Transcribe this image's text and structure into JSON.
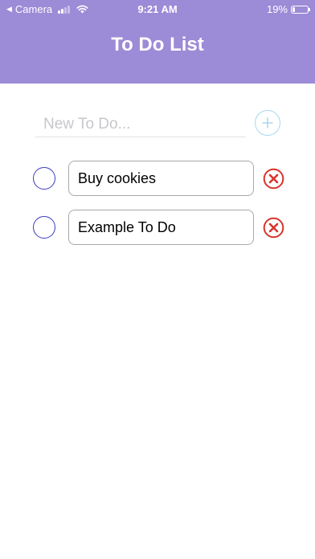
{
  "status_bar": {
    "back_app": "Camera",
    "time": "9:21 AM",
    "battery_percent": "19%",
    "battery_level": 0.19
  },
  "header": {
    "title": "To Do List",
    "background_color": "#9c8bd6"
  },
  "new_todo": {
    "value": "",
    "placeholder": "New To Do...",
    "add_icon": "plus-circle-icon"
  },
  "todos": [
    {
      "text": "Buy cookies",
      "completed": false
    },
    {
      "text": "Example To Do",
      "completed": false
    }
  ],
  "colors": {
    "check_circle": "#3b3bc2",
    "delete": "#d9342b",
    "add": "#a9d8ef"
  }
}
